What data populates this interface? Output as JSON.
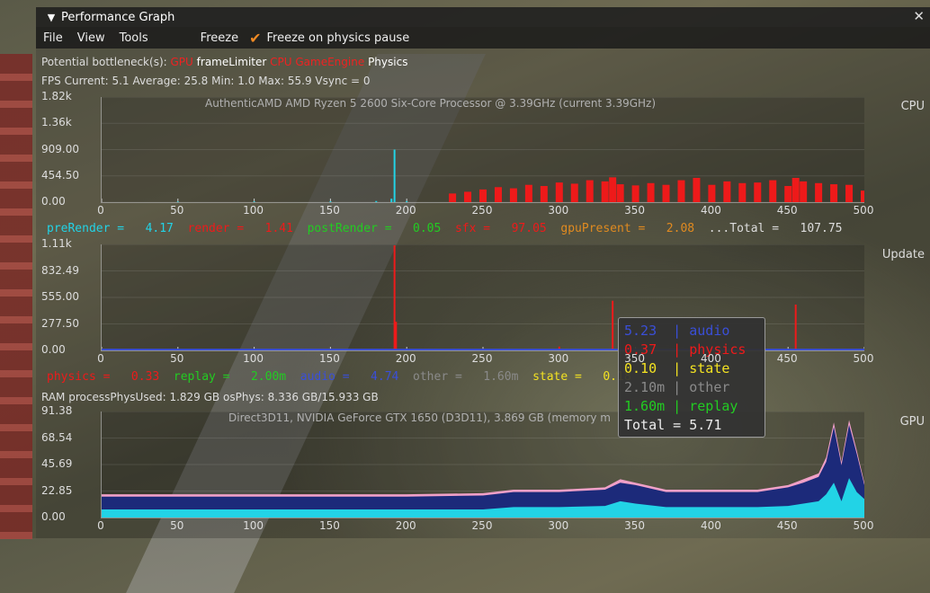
{
  "window": {
    "title": "Performance Graph",
    "close": "✕"
  },
  "menu": {
    "file": "File",
    "view": "View",
    "tools": "Tools",
    "freeze": "Freeze",
    "freeze_on_physics": "Freeze on physics pause"
  },
  "bottleneck": {
    "label": "Potential bottleneck(s):",
    "items": [
      "GPU",
      "frameLimiter",
      "CPU",
      "GameEngine",
      "Physics"
    ]
  },
  "fps": {
    "label": "FPS",
    "current": "Current:  5.1",
    "average": "Average: 25.8",
    "min": "Min:  1.0",
    "max": "Max: 55.9",
    "vsync": "Vsync = 0"
  },
  "ram": {
    "label": "RAM",
    "processPhysUsed": "processPhysUsed: 1.829 GB",
    "osPhys": "osPhys: 8.336 GB/15.933 GB"
  },
  "colors": {
    "cyan": "#22d3e6",
    "red": "#ee1a1a",
    "green": "#22cc22",
    "blue": "#3a4fd8",
    "yellow": "#f3e222",
    "grey": "#8a8a8a",
    "orange": "#e08a20",
    "navy": "#1c2a7a",
    "pink": "#f0a0c8"
  },
  "chart_data": [
    {
      "type": "bar",
      "section": "CPU",
      "title": "AuthenticAMD AMD Ryzen 5 2600 Six-Core Processor              @ 3.39GHz (current 3.39GHz)",
      "ylim": [
        0,
        1820
      ],
      "yticks": [
        "1.82k",
        "1.36k",
        "909.00",
        "454.50",
        "0.00"
      ],
      "xticks": [
        "0",
        "50",
        "100",
        "150",
        "200",
        "250",
        "300",
        "350",
        "400",
        "450",
        "500"
      ],
      "series": [
        {
          "name": "preRender",
          "color": "#22d3e6",
          "x": [
            50,
            100,
            150,
            180,
            190,
            192,
            200
          ],
          "values": [
            10,
            12,
            14,
            20,
            60,
            910,
            18
          ]
        },
        {
          "name": "sfx",
          "color": "#ee1a1a",
          "x": [
            230,
            240,
            250,
            260,
            270,
            280,
            290,
            300,
            310,
            320,
            330,
            335,
            340,
            350,
            360,
            370,
            380,
            390,
            400,
            410,
            420,
            430,
            440,
            450,
            455,
            460,
            470,
            480,
            490,
            500
          ],
          "values": [
            150,
            180,
            220,
            260,
            240,
            300,
            280,
            340,
            320,
            380,
            360,
            430,
            310,
            290,
            330,
            300,
            380,
            420,
            300,
            360,
            330,
            340,
            380,
            280,
            420,
            360,
            330,
            310,
            300,
            200
          ]
        }
      ],
      "legend": [
        {
          "name": "preRender =",
          "value": "4.17",
          "color": "#22d3e6"
        },
        {
          "name": "render =",
          "value": "1.41",
          "color": "#ee1a1a"
        },
        {
          "name": "postRender =",
          "value": "0.05",
          "color": "#22cc22"
        },
        {
          "name": "sfx =",
          "value": "97.05",
          "color": "#ee1a1a"
        },
        {
          "name": "gpuPresent =",
          "value": "2.08",
          "color": "#e08a20"
        },
        {
          "name": "...Total =",
          "value": "107.75",
          "color": "#dddddd"
        }
      ]
    },
    {
      "type": "bar",
      "section": "Update",
      "title": "",
      "ylim": [
        0,
        1110
      ],
      "yticks": [
        "1.11k",
        "832.49",
        "555.00",
        "277.50",
        "0.00"
      ],
      "xticks": [
        "0",
        "50",
        "100",
        "150",
        "200",
        "250",
        "300",
        "350",
        "400",
        "450",
        "500"
      ],
      "series": [
        {
          "name": "physics",
          "color": "#ee1a1a",
          "x": [
            192,
            193,
            300,
            335,
            455
          ],
          "values": [
            1100,
            300,
            40,
            520,
            480
          ]
        },
        {
          "name": "audio",
          "color": "#3a4fd8",
          "x": [
            0,
            500
          ],
          "values": [
            8,
            8
          ]
        }
      ],
      "legend": [
        {
          "name": "physics =",
          "value": "0.33",
          "color": "#ee1a1a"
        },
        {
          "name": "replay =",
          "value": "2.00m",
          "color": "#22cc22"
        },
        {
          "name": "audio =",
          "value": "4.74",
          "color": "#3a4fd8"
        },
        {
          "name": "other =",
          "value": "1.60m",
          "color": "#8a8a8a"
        },
        {
          "name": "state =",
          "value": "0.18",
          "color": "#f3e222"
        }
      ]
    },
    {
      "type": "area",
      "section": "GPU",
      "title": "Direct3D11, NVIDIA GeForce GTX 1650 (D3D11), 3.869 GB (memory m",
      "ylim": [
        0,
        91.38
      ],
      "yticks": [
        "91.38",
        "68.54",
        "45.69",
        "22.85",
        "0.00"
      ],
      "xticks": [
        "0",
        "50",
        "100",
        "150",
        "200",
        "250",
        "300",
        "350",
        "400",
        "450",
        "500"
      ],
      "x": [
        0,
        50,
        100,
        150,
        200,
        250,
        270,
        300,
        330,
        340,
        350,
        370,
        400,
        430,
        450,
        460,
        470,
        475,
        480,
        485,
        490,
        495,
        500
      ],
      "series": [
        {
          "name": "cyan",
          "color": "#22d3e6",
          "values": [
            7,
            7,
            7,
            7,
            7,
            7,
            9,
            9,
            10,
            14,
            12,
            9,
            9,
            9,
            10,
            12,
            14,
            20,
            30,
            14,
            34,
            22,
            16
          ]
        },
        {
          "name": "navy",
          "color": "#1c2a7a",
          "values": [
            18,
            18,
            18,
            18,
            18,
            19,
            22,
            22,
            24,
            30,
            28,
            22,
            22,
            22,
            26,
            30,
            35,
            48,
            78,
            45,
            80,
            55,
            28
          ]
        },
        {
          "name": "pink",
          "color": "#f0a0c8",
          "values": [
            20,
            20,
            20,
            20,
            20,
            21,
            24,
            24,
            26,
            33,
            30,
            24,
            24,
            24,
            28,
            33,
            38,
            52,
            82,
            48,
            84,
            58,
            30
          ]
        }
      ]
    }
  ],
  "tooltip": [
    {
      "value": "5.23",
      "name": "audio",
      "color": "#3a4fd8"
    },
    {
      "value": "0.37",
      "name": "physics",
      "color": "#ee1a1a"
    },
    {
      "value": "0.10",
      "name": "state",
      "color": "#f3e222"
    },
    {
      "value": "2.10m",
      "name": "other",
      "color": "#8a8a8a"
    },
    {
      "value": "1.60m",
      "name": "replay",
      "color": "#22cc22"
    },
    {
      "total": "Total = 5.71"
    }
  ]
}
